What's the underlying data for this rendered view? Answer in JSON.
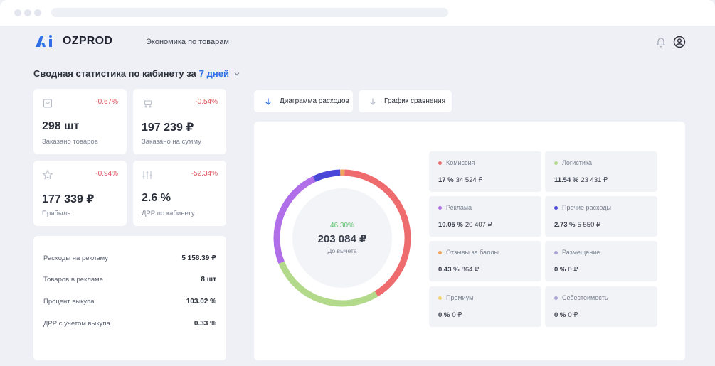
{
  "app": {
    "brand": "OZPROD",
    "nav_link": "Экономика по товарам"
  },
  "summary": {
    "title": "Сводная статистика по кабинету за",
    "period": "7 дней"
  },
  "stats": [
    {
      "icon": "bag-icon",
      "change": "-0.67%",
      "value": "298 шт",
      "label": "Заказано товаров"
    },
    {
      "icon": "cart-icon",
      "change": "-0.54%",
      "value": "197 239 ₽",
      "label": "Заказано на сумму"
    },
    {
      "icon": "star-icon",
      "change": "-0.94%",
      "value": "177 339 ₽",
      "label": "Прибыль"
    },
    {
      "icon": "sliders-icon",
      "change": "-52.34%",
      "value": "2.6 %",
      "label": "ДРР по кабинету"
    }
  ],
  "details": [
    {
      "label": "Расходы на рекламу",
      "value": "5 158.39 ₽"
    },
    {
      "label": "Товаров в рекламе",
      "value": "8 шт"
    },
    {
      "label": "Процент выкупа",
      "value": "103.02 %"
    },
    {
      "label": "ДРР с учетом выкупа",
      "value": "0.33 %"
    }
  ],
  "tabs": [
    {
      "label": "Диаграмма расходов",
      "icon": "arrow-down-icon",
      "active": true
    },
    {
      "label": "График сравнения",
      "icon": "arrow-down-icon",
      "active": false
    }
  ],
  "donut": {
    "percent": "46.30%",
    "total": "203 084 ₽",
    "caption": "До вычета"
  },
  "chart_data": {
    "type": "pie",
    "center_percent": 46.3,
    "total": 203084,
    "series": [
      {
        "name": "Комиссия",
        "percent": "17 %",
        "amount": "34 524 ₽",
        "share": 17,
        "color": "#ee6b6e"
      },
      {
        "name": "Логистика",
        "percent": "11.54 %",
        "amount": "23 431 ₽",
        "share": 11.54,
        "color": "#b3d98a"
      },
      {
        "name": "Реклама",
        "percent": "10.05 %",
        "amount": "20 407 ₽",
        "share": 10.05,
        "color": "#b06ee8"
      },
      {
        "name": "Прочие расходы",
        "percent": "2.73 %",
        "amount": "5 550 ₽",
        "share": 2.73,
        "color": "#4a47d8"
      },
      {
        "name": "Отзывы за баллы",
        "percent": "0.43 %",
        "amount": "864 ₽",
        "share": 0.43,
        "color": "#f0a35c"
      },
      {
        "name": "Размещение",
        "percent": "0 %",
        "amount": "0 ₽",
        "share": 0,
        "color": "#a9a3d6"
      },
      {
        "name": "Премиум",
        "percent": "0 %",
        "amount": "0 ₽",
        "share": 0,
        "color": "#f2d36b"
      },
      {
        "name": "Себестоимость",
        "percent": "0 %",
        "amount": "0 ₽",
        "share": 0,
        "color": "#a9a3d6"
      }
    ]
  }
}
